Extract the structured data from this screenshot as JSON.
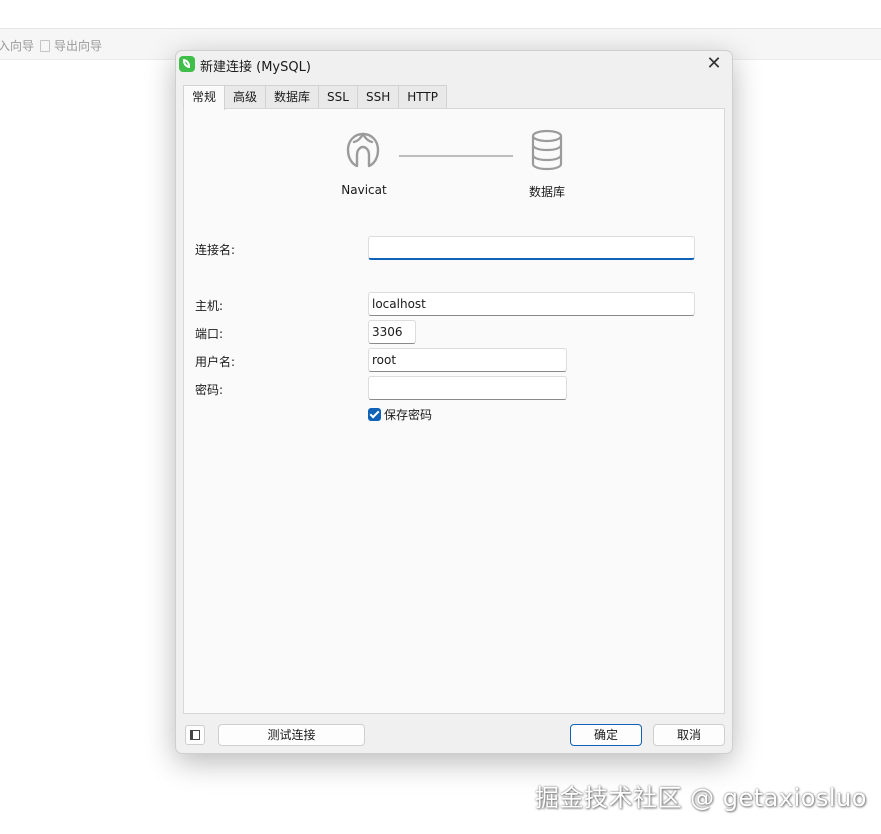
{
  "background": {
    "toolbar": {
      "import_label": "入向导",
      "export_label": "导出向导"
    }
  },
  "dialog": {
    "title": "新建连接 (MySQL)",
    "tabs": [
      "常规",
      "高级",
      "数据库",
      "SSL",
      "SSH",
      "HTTP"
    ],
    "active_tab": "常规",
    "diagram": {
      "left_label": "Navicat",
      "right_label": "数据库"
    },
    "form": {
      "connection_name": {
        "label": "连接名:",
        "value": ""
      },
      "host": {
        "label": "主机:",
        "value": "localhost"
      },
      "port": {
        "label": "端口:",
        "value": "3306"
      },
      "username": {
        "label": "用户名:",
        "value": "root"
      },
      "password": {
        "label": "密码:",
        "value": ""
      },
      "save_password": {
        "label": "保存密码",
        "checked": true
      }
    },
    "buttons": {
      "test": "测试连接",
      "ok": "确定",
      "cancel": "取消"
    }
  },
  "watermark": "掘金技术社区 @ getaxiosluo",
  "colors": {
    "accent": "#1062b8",
    "navicat_green": "#3fbf4a"
  }
}
